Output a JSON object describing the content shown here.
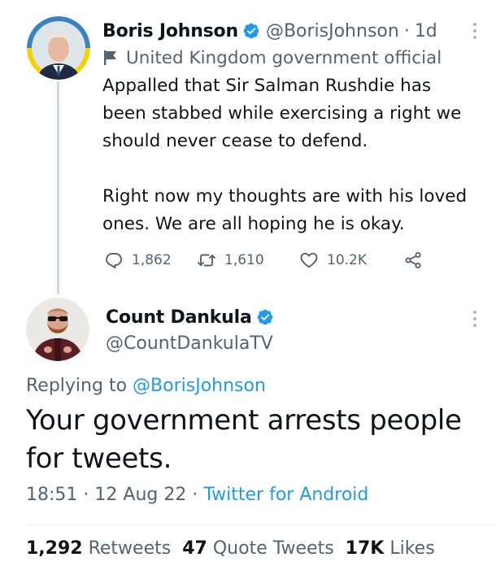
{
  "parent_tweet": {
    "author_name": "Boris Johnson",
    "handle": "@BorisJohnson",
    "separator": "·",
    "time": "1d",
    "label": "United Kingdom government official",
    "body_lines": [
      "Appalled that Sir Salman Rushdie has",
      "been stabbed while exercising a right we",
      "should never cease to defend.",
      "Right now my thoughts are with his loved",
      "ones. We are all hoping he is okay."
    ],
    "replies": "1,862",
    "retweets": "1,610",
    "likes": "10.2K",
    "icons": {
      "reply": "reply-icon",
      "retweet": "retweet-icon",
      "like": "heart-icon",
      "share": "share-icon",
      "label": "government-flag-icon"
    }
  },
  "focused_tweet": {
    "author_name": "Count Dankula",
    "handle": "@CountDankulaTV",
    "replying_prefix": "Replying to",
    "replying_to": "@BorisJohnson",
    "body_lines": [
      "Your government arrests people",
      "for tweets."
    ],
    "time": "18:51",
    "dot": "·",
    "date": "12 Aug 22",
    "source": "Twitter for Android",
    "stats": {
      "retweets_count": "1,292",
      "retweets_label": "Retweets",
      "quotes_count": "47",
      "quotes_label": "Quote Tweets",
      "likes_count": "17K",
      "likes_label": "Likes"
    }
  },
  "colors": {
    "accent": "#1d9bf0",
    "text": "#0f1419",
    "secondary": "#536471",
    "verified": "#1d9bf0",
    "avatar_ring_top": "#3b82c4",
    "avatar_ring_bottom": "#f5d200"
  }
}
